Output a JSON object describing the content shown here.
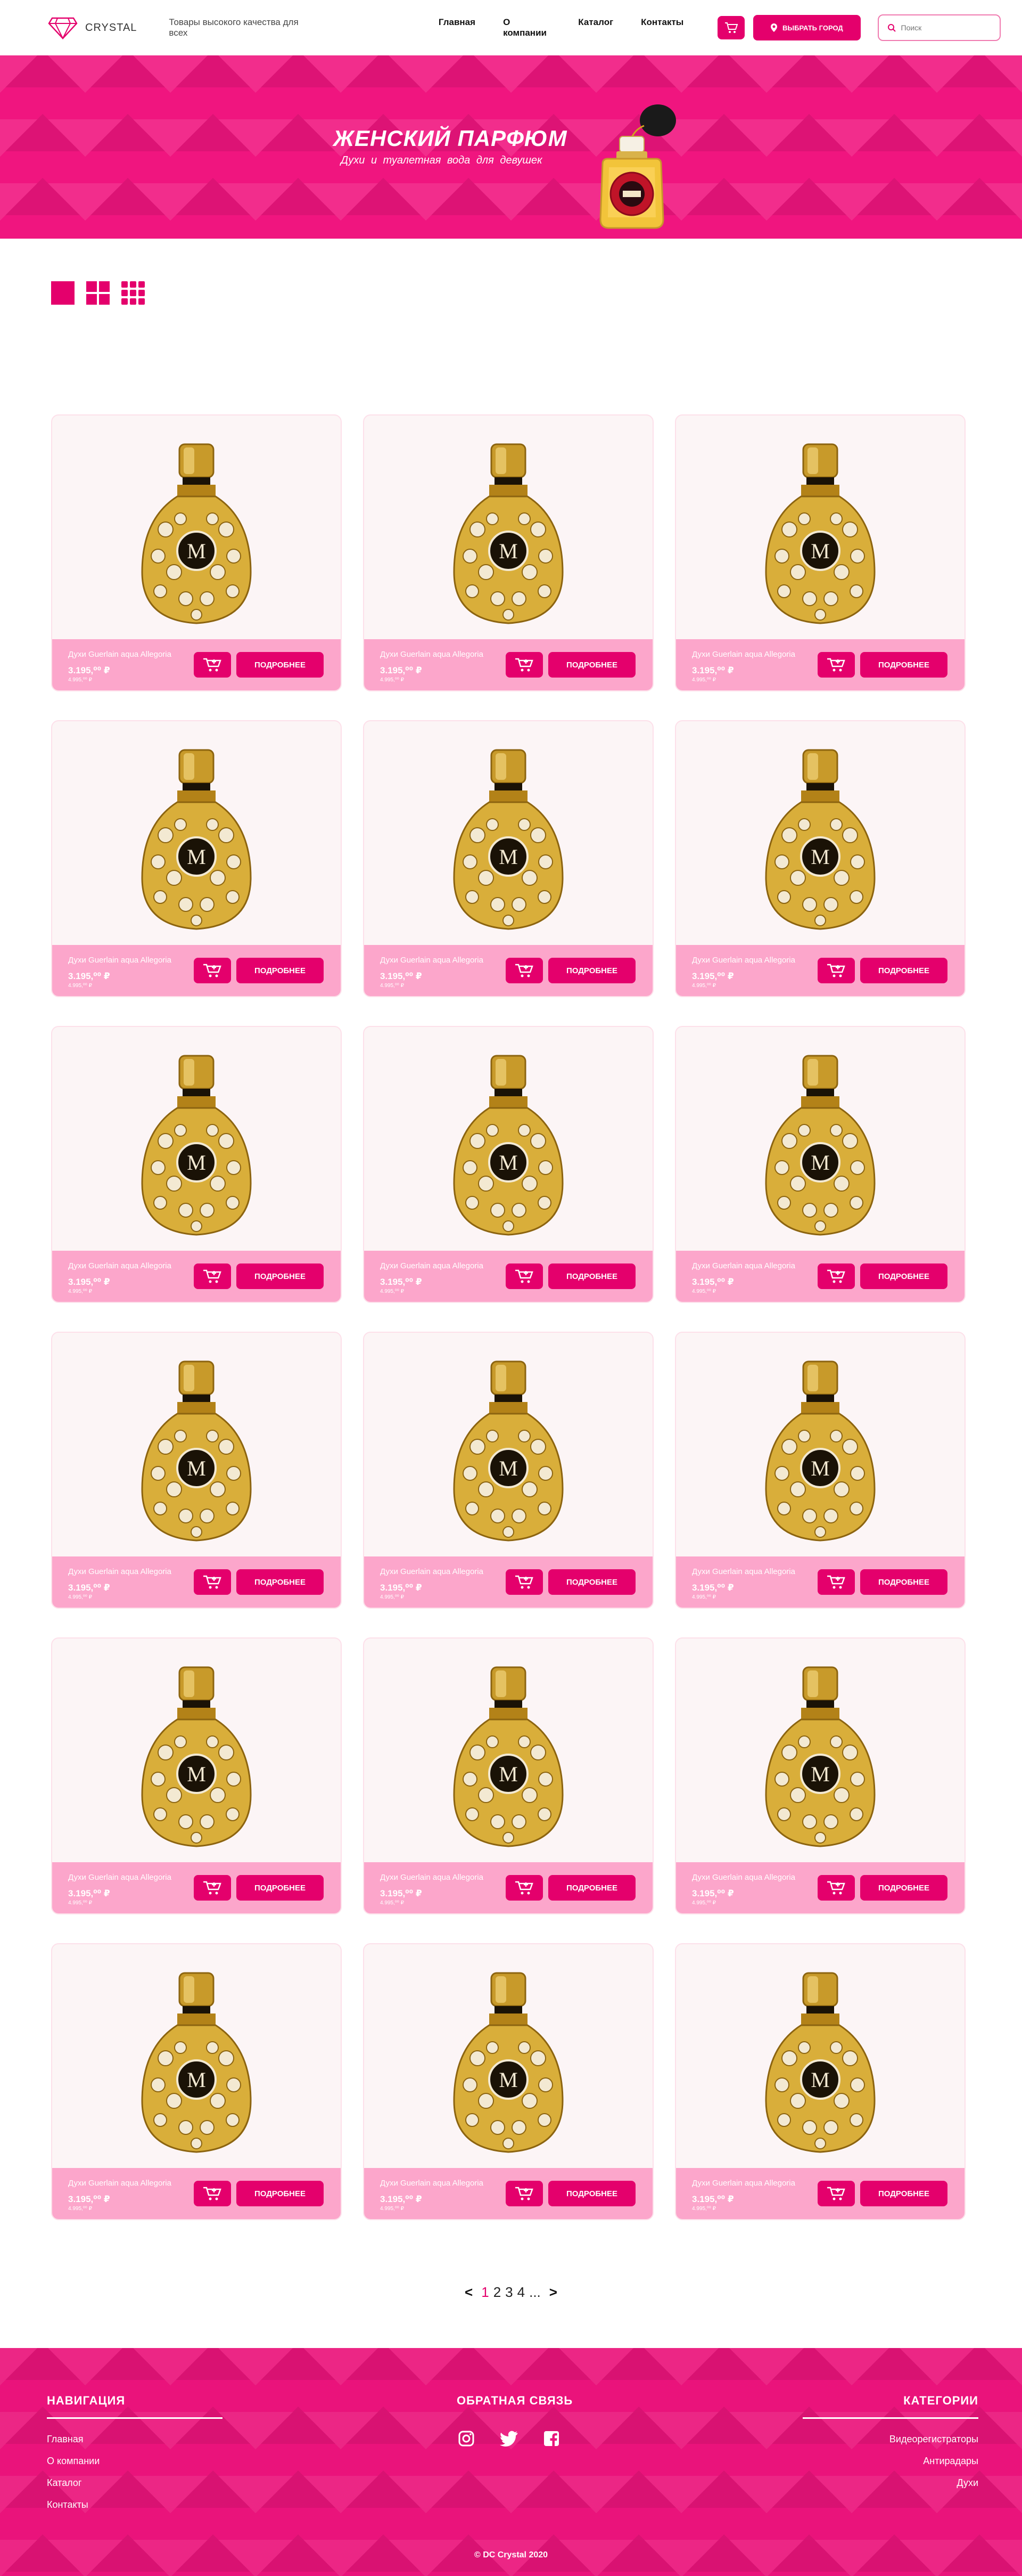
{
  "header": {
    "logo_text": "CRYSTAL",
    "tagline": "Товары высокого качества для всех",
    "nav": [
      "Главная",
      "О компании",
      "Каталог",
      "Контакты"
    ],
    "city_button": "ВЫБРАТЬ ГОРОД",
    "search_placeholder": "Поиск"
  },
  "banner": {
    "title": "ЖЕНСКИЙ ПАРФЮМ",
    "subtitle": "Духи и туалетная вода для девушек"
  },
  "colors": {
    "accent": "#e4006c",
    "banner_bg": "#f0157f",
    "card_bar": "#fca6cb",
    "card_bg": "#fcf5f6"
  },
  "products": [
    {
      "name": "Духи Guerlain aqua Allegoria",
      "price": "3.195,⁰⁰ ₽",
      "old_price": "4.995,⁰⁰ ₽",
      "button": "ПОДРОБНЕЕ"
    },
    {
      "name": "Духи Guerlain aqua Allegoria",
      "price": "3.195,⁰⁰ ₽",
      "old_price": "4.995,⁰⁰ ₽",
      "button": "ПОДРОБНЕЕ"
    },
    {
      "name": "Духи Guerlain aqua Allegoria",
      "price": "3.195,⁰⁰ ₽",
      "old_price": "4.995,⁰⁰ ₽",
      "button": "ПОДРОБНЕЕ"
    },
    {
      "name": "Духи Guerlain aqua Allegoria",
      "price": "3.195,⁰⁰ ₽",
      "old_price": "4.995,⁰⁰ ₽",
      "button": "ПОДРОБНЕЕ"
    },
    {
      "name": "Духи Guerlain aqua Allegoria",
      "price": "3.195,⁰⁰ ₽",
      "old_price": "4.995,⁰⁰ ₽",
      "button": "ПОДРОБНЕЕ"
    },
    {
      "name": "Духи Guerlain aqua Allegoria",
      "price": "3.195,⁰⁰ ₽",
      "old_price": "4.995,⁰⁰ ₽",
      "button": "ПОДРОБНЕЕ"
    },
    {
      "name": "Духи Guerlain aqua Allegoria",
      "price": "3.195,⁰⁰ ₽",
      "old_price": "4.995,⁰⁰ ₽",
      "button": "ПОДРОБНЕЕ"
    },
    {
      "name": "Духи Guerlain aqua Allegoria",
      "price": "3.195,⁰⁰ ₽",
      "old_price": "4.995,⁰⁰ ₽",
      "button": "ПОДРОБНЕЕ"
    },
    {
      "name": "Духи Guerlain aqua Allegoria",
      "price": "3.195,⁰⁰ ₽",
      "old_price": "4.995,⁰⁰ ₽",
      "button": "ПОДРОБНЕЕ"
    },
    {
      "name": "Духи Guerlain aqua Allegoria",
      "price": "3.195,⁰⁰ ₽",
      "old_price": "4.995,⁰⁰ ₽",
      "button": "ПОДРОБНЕЕ"
    },
    {
      "name": "Духи Guerlain aqua Allegoria",
      "price": "3.195,⁰⁰ ₽",
      "old_price": "4.995,⁰⁰ ₽",
      "button": "ПОДРОБНЕЕ"
    },
    {
      "name": "Духи Guerlain aqua Allegoria",
      "price": "3.195,⁰⁰ ₽",
      "old_price": "4.995,⁰⁰ ₽",
      "button": "ПОДРОБНЕЕ"
    },
    {
      "name": "Духи Guerlain aqua Allegoria",
      "price": "3.195,⁰⁰ ₽",
      "old_price": "4.995,⁰⁰ ₽",
      "button": "ПОДРОБНЕЕ"
    },
    {
      "name": "Духи Guerlain aqua Allegoria",
      "price": "3.195,⁰⁰ ₽",
      "old_price": "4.995,⁰⁰ ₽",
      "button": "ПОДРОБНЕЕ"
    },
    {
      "name": "Духи Guerlain aqua Allegoria",
      "price": "3.195,⁰⁰ ₽",
      "old_price": "4.995,⁰⁰ ₽",
      "button": "ПОДРОБНЕЕ"
    },
    {
      "name": "Духи Guerlain aqua Allegoria",
      "price": "3.195,⁰⁰ ₽",
      "old_price": "4.995,⁰⁰ ₽",
      "button": "ПОДРОБНЕЕ"
    },
    {
      "name": "Духи Guerlain aqua Allegoria",
      "price": "3.195,⁰⁰ ₽",
      "old_price": "4.995,⁰⁰ ₽",
      "button": "ПОДРОБНЕЕ"
    },
    {
      "name": "Духи Guerlain aqua Allegoria",
      "price": "3.195,⁰⁰ ₽",
      "old_price": "4.995,⁰⁰ ₽",
      "button": "ПОДРОБНЕЕ"
    }
  ],
  "pagination": {
    "prev": "<",
    "pages": [
      "1",
      "2",
      "3",
      "4"
    ],
    "ellipsis": "...",
    "next": ">",
    "current": "1"
  },
  "footer": {
    "nav_title": "НАВИГАЦИЯ",
    "nav_links": [
      "Главная",
      "О компании",
      "Каталог",
      "Контакты"
    ],
    "feedback_title": "ОБРАТНАЯ СВЯЗЬ",
    "social_icons": [
      "instagram-icon",
      "twitter-icon",
      "facebook-icon"
    ],
    "categories_title": "КАТЕГОРИИ",
    "categories": [
      "Видеорегистраторы",
      "Антирадары",
      "Духи"
    ],
    "copyright": "© DC Crystal 2020"
  }
}
